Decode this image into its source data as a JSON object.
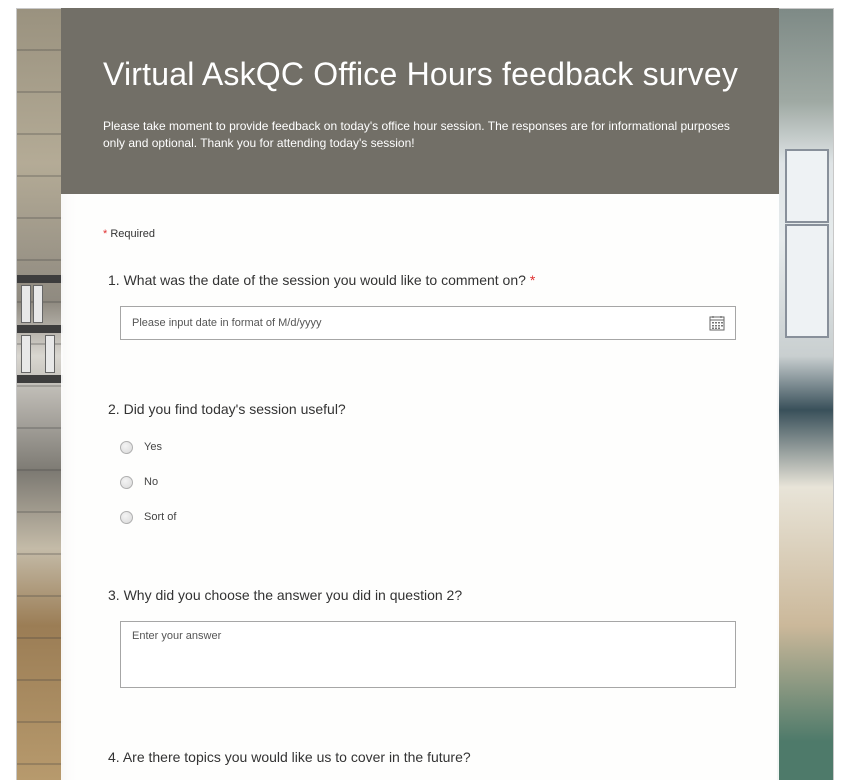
{
  "form": {
    "title": "Virtual AskQC Office Hours feedback survey",
    "description": "Please take moment to provide feedback on today's office hour session. The responses are for informational purposes only and optional. Thank you for attending today's session!",
    "required_star": "*",
    "required_label": "Required",
    "header_color": "#726f67",
    "required_color": "#e03030"
  },
  "questions": [
    {
      "number": "1.",
      "text": "What was the date of the session you would like to comment on?",
      "required_mark": "*",
      "input_placeholder": "Please input date in format of M/d/yyyy",
      "icon": "calendar-icon"
    },
    {
      "number": "2.",
      "text": "Did you find today's session useful?",
      "options": [
        "Yes",
        "No",
        "Sort of"
      ]
    },
    {
      "number": "3.",
      "text": "Why did you choose the answer you did in question 2?",
      "input_placeholder": "Enter your answer"
    },
    {
      "number": "4.",
      "text": "Are there topics you would like us to cover in the future?"
    }
  ]
}
